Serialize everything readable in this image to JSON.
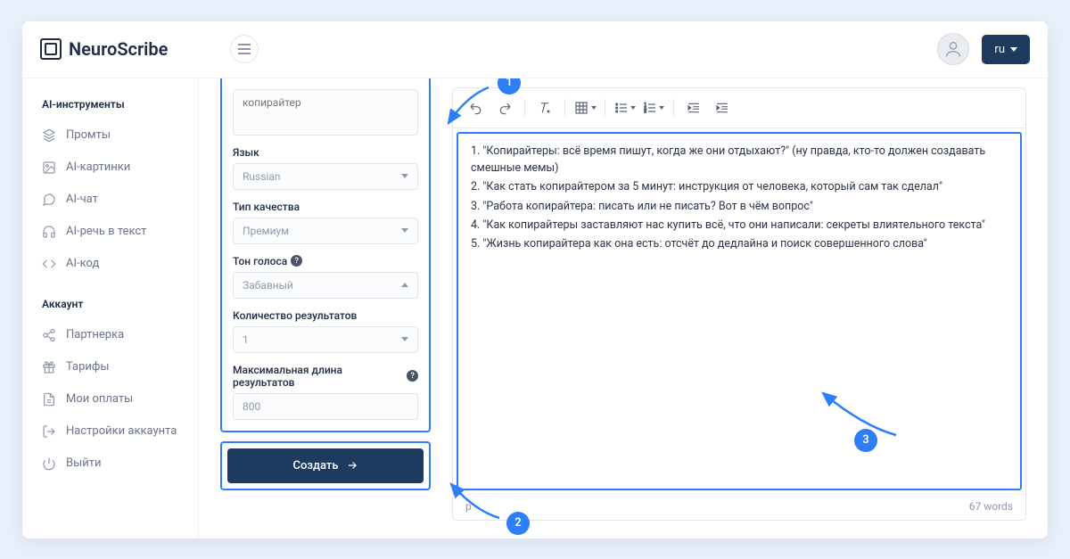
{
  "brand": {
    "name": "NeuroScribe"
  },
  "lang_button": "ru",
  "sidebar": {
    "section1_title": "AI-инструменты",
    "items1": [
      {
        "label": "Промты"
      },
      {
        "label": "AI-картинки"
      },
      {
        "label": "AI-чат"
      },
      {
        "label": "AI-речь в текст"
      },
      {
        "label": "AI-код"
      }
    ],
    "section2_title": "Аккаунт",
    "items2": [
      {
        "label": "Партнерка"
      },
      {
        "label": "Тарифы"
      },
      {
        "label": "Мои оплаты"
      },
      {
        "label": "Настройки аккаунта"
      },
      {
        "label": "Выйти"
      }
    ]
  },
  "form": {
    "topic_placeholder": "копирайтер",
    "lang_label": "Язык",
    "lang_value": "Russian",
    "quality_label": "Тип качества",
    "quality_value": "Премиум",
    "tone_label": "Тон голоса",
    "tone_value": "Забавный",
    "count_label": "Количество результатов",
    "count_value": "1",
    "maxlen_label": "Максимальная длина результатов",
    "maxlen_value": "800",
    "submit_label": "Создать"
  },
  "editor": {
    "lines": [
      "1. \"Копирайтеры: всё время пишут, когда же они отдыхают?\" (ну правда, кто-то должен создавать смешные мемы)",
      "2. \"Как стать копирайтером за 5 минут: инструкция от человека, который сам так сделал\"",
      "3. \"Работа копирайтера: писать или не писать? Вот в чём вопрос\"",
      "4. \"Как копирайтеры заставляют нас купить всё, что они написали: секреты влиятельного текста\"",
      "5. \"Жизнь копирайтера как она есть: отсчёт до дедлайна и поиск совершенного слова\""
    ],
    "footer_tag": "p",
    "footer_words": "67 words"
  },
  "callouts": {
    "c1": "1",
    "c2": "2",
    "c3": "3"
  }
}
